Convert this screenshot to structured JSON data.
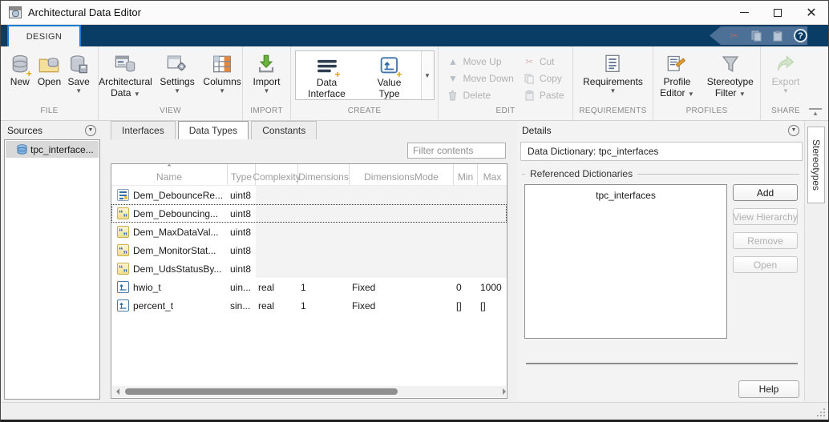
{
  "window": {
    "title": "Architectural Data Editor"
  },
  "colors": {
    "ribbon_navy": "#0a3d66",
    "active_tab_border": "#1d7ad4",
    "selection_gray": "#d9d9d9",
    "columns_accent_orange": "#e8873a",
    "import_green": "#57a22e"
  },
  "ribbon": {
    "tab_label": "DESIGN",
    "file": {
      "label": "FILE",
      "new": "New",
      "open": "Open",
      "save": "Save"
    },
    "view": {
      "label": "VIEW",
      "arch_data_line1": "Architectural",
      "arch_data_line2": "Data",
      "settings": "Settings",
      "columns": "Columns"
    },
    "import": {
      "label": "IMPORT",
      "import": "Import"
    },
    "create": {
      "label": "CREATE",
      "data_interface_line1": "Data",
      "data_interface_line2": "Interface",
      "value_type_line1": "Value",
      "value_type_line2": "Type"
    },
    "edit": {
      "label": "EDIT",
      "move_up": "Move Up",
      "move_down": "Move Down",
      "delete": "Delete",
      "cut": "Cut",
      "copy": "Copy",
      "paste": "Paste"
    },
    "requirements": {
      "label": "REQUIREMENTS",
      "requirements": "Requirements"
    },
    "profiles": {
      "label": "PROFILES",
      "profile_editor_line1": "Profile",
      "profile_editor_line2": "Editor",
      "stereotype_filter_line1": "Stereotype",
      "stereotype_filter_line2": "Filter"
    },
    "share": {
      "label": "SHARE",
      "export": "Export"
    }
  },
  "sources": {
    "title": "Sources",
    "items": [
      {
        "label": "tpc_interface..."
      }
    ]
  },
  "content_tabs": {
    "interfaces": "Interfaces",
    "data_types": "Data Types",
    "constants": "Constants"
  },
  "filter": {
    "placeholder": "Filter contents"
  },
  "table": {
    "columns": {
      "name": "Name",
      "type": "Type",
      "complexity": "Complexity",
      "dimensions": "Dimensions",
      "dimensions_mode": "DimensionsMode",
      "min": "Min",
      "max": "Max"
    },
    "rows": [
      {
        "name": "Dem_DebounceRe...",
        "type": "uint8",
        "complexity": "",
        "dimensions": "",
        "dimensions_mode": "",
        "min": "",
        "max": ""
      },
      {
        "name": "Dem_Debouncing...",
        "type": "uint8",
        "complexity": "",
        "dimensions": "",
        "dimensions_mode": "",
        "min": "",
        "max": ""
      },
      {
        "name": "Dem_MaxDataVal...",
        "type": "uint8",
        "complexity": "",
        "dimensions": "",
        "dimensions_mode": "",
        "min": "",
        "max": ""
      },
      {
        "name": "Dem_MonitorStat...",
        "type": "uint8",
        "complexity": "",
        "dimensions": "",
        "dimensions_mode": "",
        "min": "",
        "max": ""
      },
      {
        "name": "Dem_UdsStatusBy...",
        "type": "uint8",
        "complexity": "",
        "dimensions": "",
        "dimensions_mode": "",
        "min": "",
        "max": ""
      },
      {
        "name": "hwio_t",
        "type": "uin...",
        "complexity": "real",
        "dimensions": "1",
        "dimensions_mode": "Fixed",
        "min": "0",
        "max": "1000"
      },
      {
        "name": "percent_t",
        "type": "sin...",
        "complexity": "real",
        "dimensions": "1",
        "dimensions_mode": "Fixed",
        "min": "[]",
        "max": "[]"
      }
    ]
  },
  "details": {
    "title": "Details",
    "dictionary_label": "Data Dictionary: tpc_interfaces",
    "referenced_label": "Referenced Dictionaries",
    "referenced_items": [
      {
        "label": "tpc_interfaces"
      }
    ],
    "buttons": {
      "add": "Add",
      "view_hierarchy": "View Hierarchy",
      "remove": "Remove",
      "open": "Open"
    },
    "help": "Help"
  },
  "right_strip": {
    "stereotypes": "Stereotypes"
  }
}
